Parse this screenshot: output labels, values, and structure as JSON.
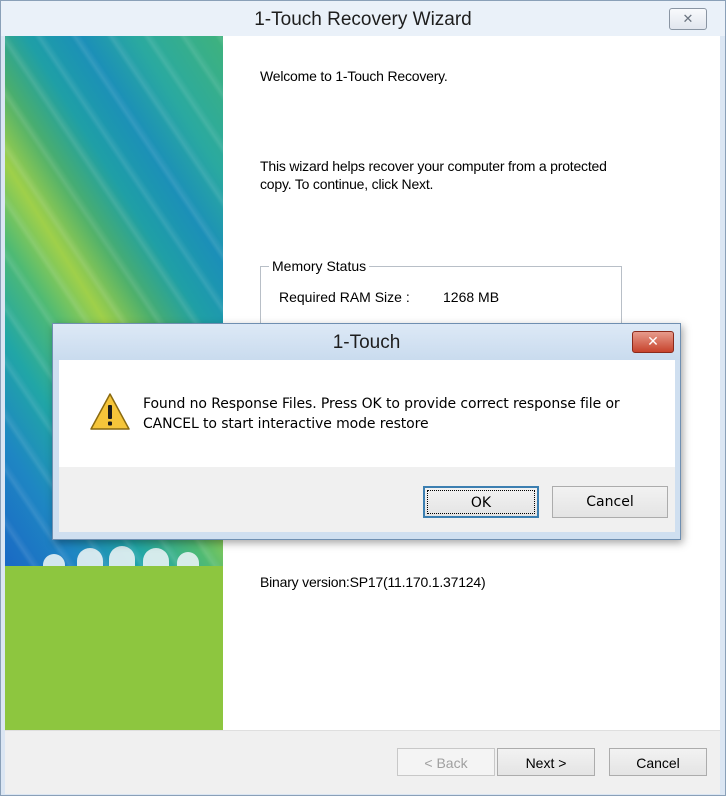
{
  "wizard": {
    "title": "1-Touch Recovery Wizard",
    "close_glyph": "✕",
    "welcome": "Welcome to 1-Touch Recovery.",
    "help_line1": "This wizard helps recover your computer from a protected",
    "help_line2": "copy. To continue, click Next.",
    "memory": {
      "legend": "Memory Status",
      "label": "Required RAM Size :",
      "value": "1268 MB"
    },
    "binary_version": "Binary version:SP17(11.170.1.37124)",
    "buttons": {
      "back": "< Back",
      "next": "Next >",
      "cancel": "Cancel"
    }
  },
  "dialog": {
    "title": "1-Touch",
    "close_glyph": "✕",
    "message_line1": "Found no Response Files. Press OK to provide correct response file or",
    "message_line2": "CANCEL to start interactive mode restore",
    "icon": "warning-icon",
    "buttons": {
      "ok": "OK",
      "cancel": "Cancel"
    }
  },
  "colors": {
    "banner_green": "#8dc63f",
    "warning_yellow": "#f5c53a",
    "dialog_close_red": "#c7432c"
  }
}
